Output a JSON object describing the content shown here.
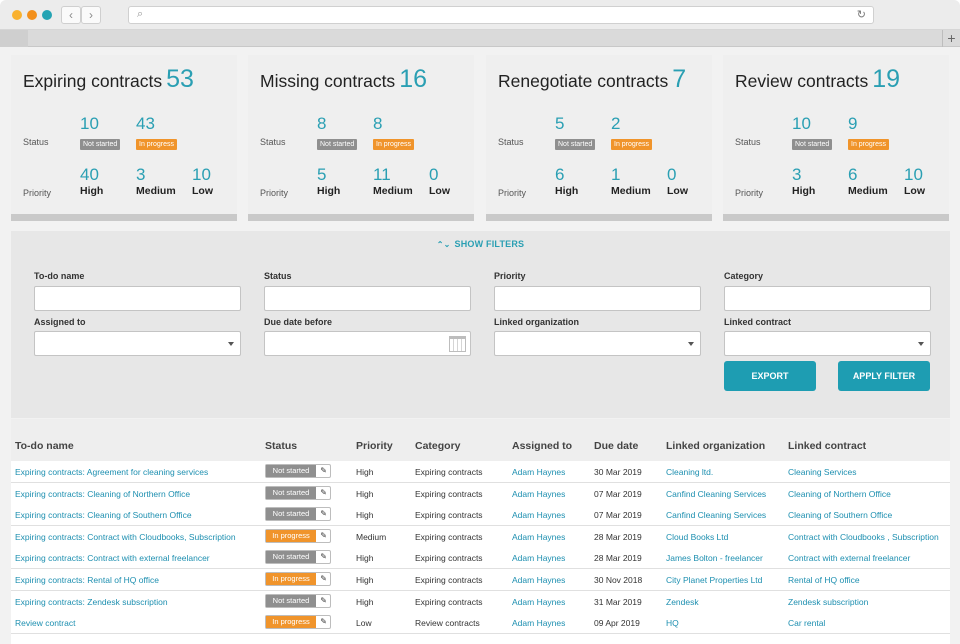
{
  "toolbar": {
    "back_icon": "‹",
    "forward_icon": "›",
    "reload_icon": "↻",
    "search_icon": "⌕",
    "new_tab_icon": "+"
  },
  "colors": {
    "accent": "#2a9fb3",
    "not_started": "#8f8f8f",
    "in_progress": "#f0942b",
    "button": "#1e9db2"
  },
  "cards": [
    {
      "title": "Expiring contracts",
      "count": "53",
      "not_started": "10",
      "in_progress": "43",
      "high": "40",
      "medium": "3",
      "low": "10"
    },
    {
      "title": "Missing contracts",
      "count": "16",
      "not_started": "8",
      "in_progress": "8",
      "high": "5",
      "medium": "11",
      "low": "0"
    },
    {
      "title": "Renegotiate contracts",
      "count": "7",
      "not_started": "5",
      "in_progress": "2",
      "high": "6",
      "medium": "1",
      "low": "0"
    },
    {
      "title": "Review contracts",
      "count": "19",
      "not_started": "10",
      "in_progress": "9",
      "high": "3",
      "medium": "6",
      "low": "10"
    }
  ],
  "card_labels": {
    "status": "Status",
    "priority": "Priority",
    "not_started": "Not started",
    "in_progress": "In progress",
    "high": "High",
    "medium": "Medium",
    "low": "Low"
  },
  "filters": {
    "toggle_icon": "⌃⌄",
    "toggle_label": "SHOW FILTERS",
    "todo_name": "To-do name",
    "status": "Status",
    "priority": "Priority",
    "category": "Category",
    "assigned_to": "Assigned to",
    "due_date_before": "Due date before",
    "linked_organization": "Linked organization",
    "linked_contract": "Linked contract",
    "export": "EXPORT",
    "apply": "APPLY FILTER"
  },
  "table": {
    "headers": [
      "To-do name",
      "Status",
      "Priority",
      "Category",
      "Assigned to",
      "Due date",
      "Linked organization",
      "Linked contract"
    ],
    "edit_icon": "✎",
    "rows": [
      {
        "name": "Expiring contracts: Agreement for cleaning services",
        "status": "Not started",
        "status_type": "gray",
        "priority": "High",
        "category": "Expiring contracts",
        "assigned": "Adam Haynes",
        "due": "30 Mar 2019",
        "org": "Cleaning ltd.",
        "contract": "Cleaning Services"
      },
      {
        "name": "Expiring contracts: Cleaning of Northern Office",
        "status": "Not started",
        "status_type": "gray",
        "priority": "High",
        "category": "Expiring contracts",
        "assigned": "Adam Haynes",
        "due": "07 Mar 2019",
        "org": "Canfind Cleaning Services",
        "contract": "Cleaning of Northern Office"
      },
      {
        "name": "Expiring contracts: Cleaning of Southern Office",
        "status": "Not started",
        "status_type": "gray",
        "priority": "High",
        "category": "Expiring contracts",
        "assigned": "Adam Haynes",
        "due": "07 Mar 2019",
        "org": "Canfind Cleaning Services",
        "contract": "Cleaning of Southern Office"
      },
      {
        "name": "Expiring contracts: Contract with Cloudbooks, Subscription",
        "status": "In progress",
        "status_type": "orange",
        "priority": "Medium",
        "category": "Expiring contracts",
        "assigned": "Adam Haynes",
        "due": "28 Mar 2019",
        "org": "Cloud Books Ltd",
        "contract": "Contract with Cloudbooks , Subscription"
      },
      {
        "name": "Expiring contracts: Contract with external freelancer",
        "status": "Not started",
        "status_type": "gray",
        "priority": "High",
        "category": "Expiring contracts",
        "assigned": "Adam Haynes",
        "due": "28 Mar 2019",
        "org": "James Bolton - freelancer",
        "contract": "Contract with external freelancer"
      },
      {
        "name": "Expiring contracts: Rental of HQ office",
        "status": "In progress",
        "status_type": "orange",
        "priority": "High",
        "category": "Expiring contracts",
        "assigned": "Adam Haynes",
        "due": "30 Nov 2018",
        "org": "City Planet Properties Ltd",
        "contract": "Rental of HQ office"
      },
      {
        "name": "Expiring contracts: Zendesk subscription",
        "status": "Not started",
        "status_type": "gray",
        "priority": "High",
        "category": "Expiring contracts",
        "assigned": "Adam Haynes",
        "due": "31 Mar 2019",
        "org": "Zendesk",
        "contract": "Zendesk subscription"
      },
      {
        "name": "Review contract",
        "status": "In progress",
        "status_type": "orange",
        "priority": "Low",
        "category": "Review contracts",
        "assigned": "Adam Haynes",
        "due": "09 Apr 2019",
        "org": "HQ",
        "contract": "Car rental"
      }
    ]
  }
}
